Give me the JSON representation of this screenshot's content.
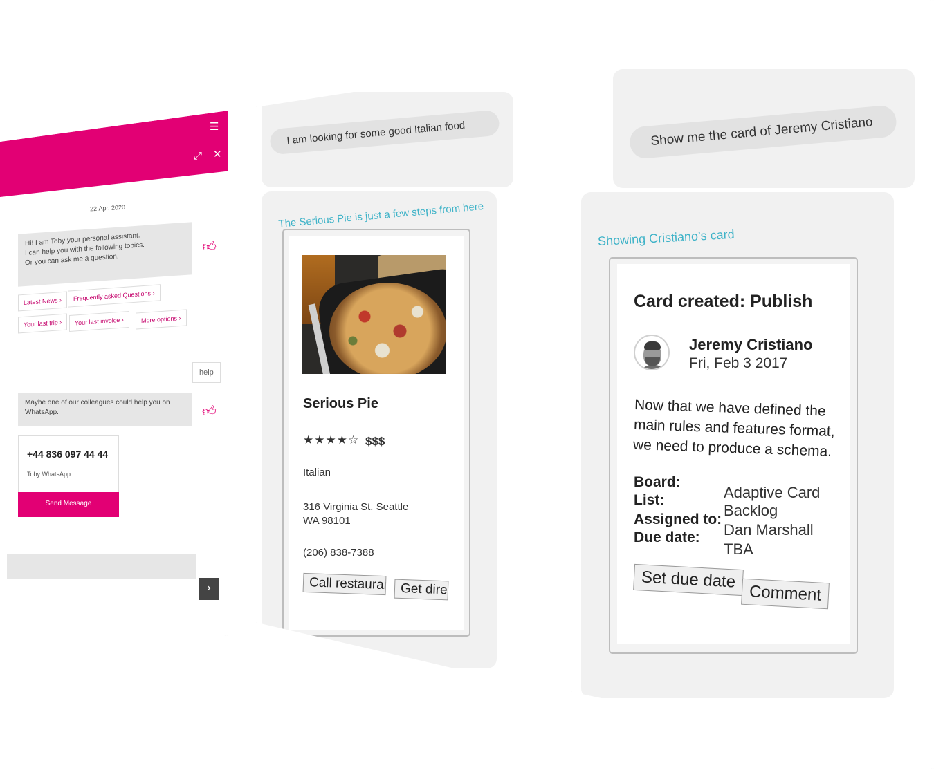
{
  "chat_widget": {
    "brand_color": "#e20074",
    "icons": {
      "menu": "menu-icon",
      "expand": "expand-icon",
      "close": "close-icon",
      "like": "thumbs-up-icon",
      "send": "chevron-right-icon"
    },
    "date": "22.Apr. 2020",
    "greeting_lines": [
      "Hi! I am Toby your personal assistant.",
      "I can help you with the following topics.",
      "Or you can ask me a question."
    ],
    "chips": [
      "Latest News",
      "Frequently asked Questions",
      "Your last trip",
      "Your last invoice",
      "More options"
    ],
    "user_message": "help",
    "bot_reply_lines": [
      "Maybe one of our colleagues could help you on",
      "WhatsApp."
    ],
    "whatsapp_number": "+44 836 097 44 44",
    "whatsapp_label": "Toby WhatsApp",
    "send_button": "Send Message"
  },
  "restaurant_panel": {
    "user_message": "I am looking for some good Italian food",
    "bot_message": "The Serious Pie is just a few steps from here",
    "accent_color": "#3fb3c8",
    "card": {
      "name": "Serious Pie",
      "rating_stars": "★★★★☆",
      "price": "$$$",
      "cuisine": "Italian",
      "address_line1": "316 Virginia St. Seattle",
      "address_line2": "WA 98101",
      "phone": "(206) 838-7388",
      "actions": [
        "Call restaurant",
        "Get dire"
      ]
    }
  },
  "card_panel": {
    "user_message": "Show me the card of Jeremy Cristiano",
    "bot_message": "Showing Cristiano’s card",
    "card": {
      "title": "Card created: Publish",
      "person_name": "Jeremy Cristiano",
      "person_date": "Fri, Feb 3 2017",
      "body_lines": [
        "Now that we have defined the",
        "main rules and features format,",
        "we need to produce a schema."
      ],
      "facts": [
        {
          "key": "Board:",
          "value": "Adaptive Card"
        },
        {
          "key": "List:",
          "value": "Backlog"
        },
        {
          "key": "Assigned to:",
          "value": "Dan Marshall"
        },
        {
          "key": "Due date:",
          "value": "TBA"
        }
      ],
      "actions": [
        "Set due date",
        "Comment"
      ]
    }
  }
}
